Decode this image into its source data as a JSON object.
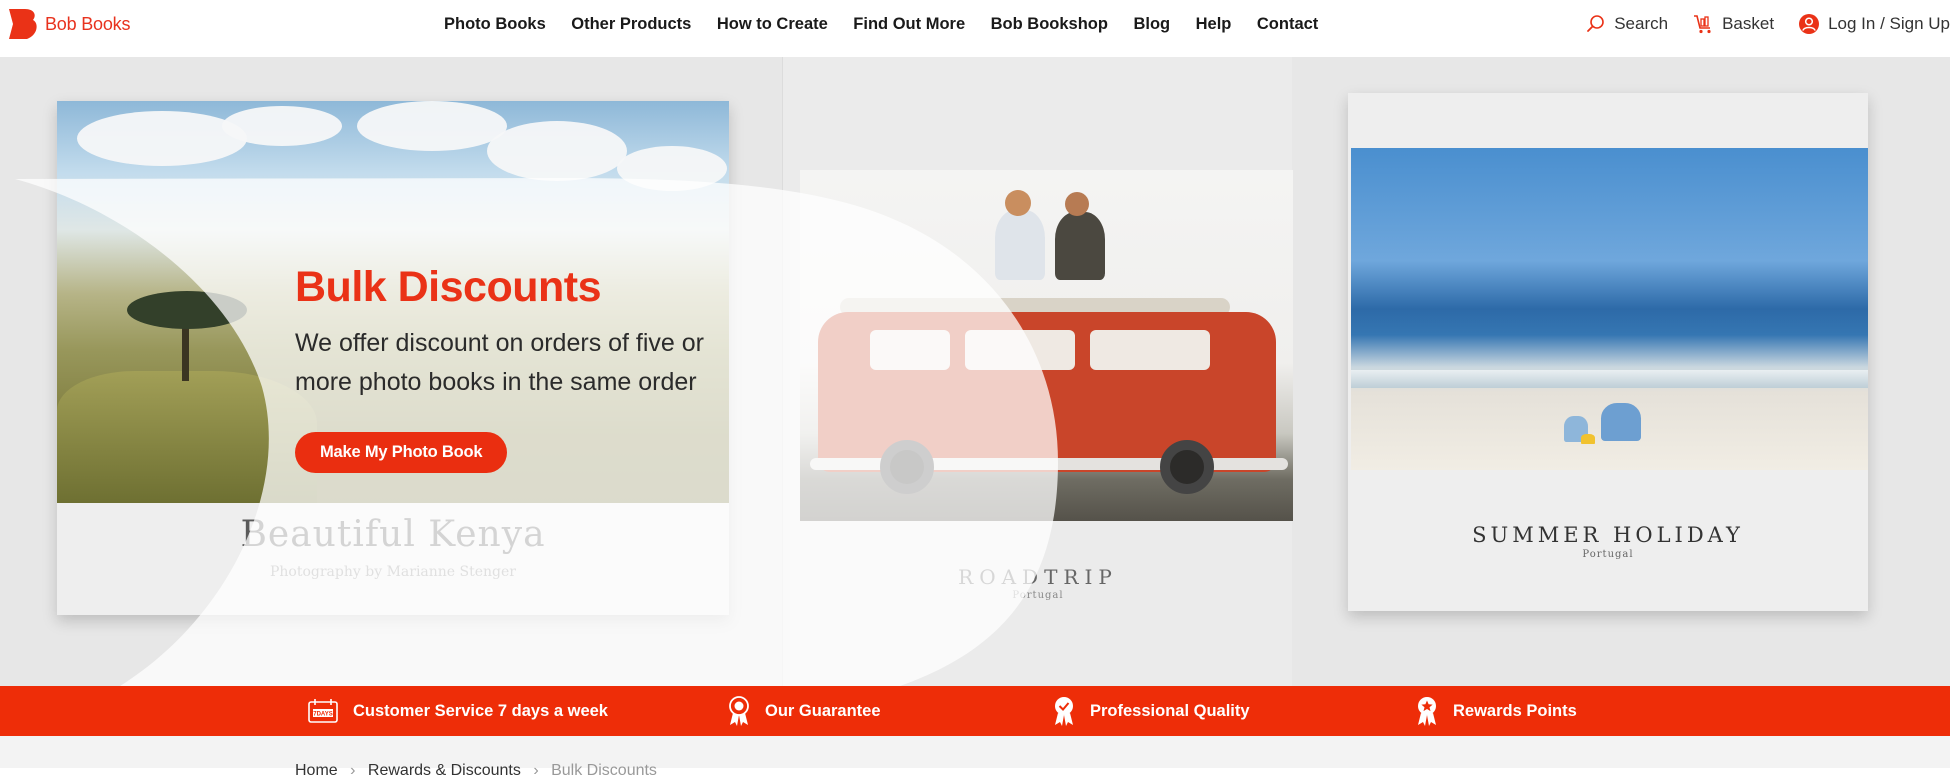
{
  "brand": {
    "name": "Bob Books",
    "color": "#e8321e"
  },
  "nav": {
    "items": [
      {
        "label": "Photo Books"
      },
      {
        "label": "Other Products"
      },
      {
        "label": "How to Create"
      },
      {
        "label": "Find Out More"
      },
      {
        "label": "Bob Bookshop"
      },
      {
        "label": "Blog"
      },
      {
        "label": "Help"
      },
      {
        "label": "Contact"
      }
    ]
  },
  "utility": {
    "search_label": "Search",
    "basket_label": "Basket",
    "login_label": "Log In / Sign Up",
    "search_icon": "search-icon",
    "basket_icon": "basket-icon",
    "user_icon": "user-icon"
  },
  "hero": {
    "title": "Bulk Discounts",
    "subtitle": "We offer discount on orders of five or more photo books in the same order",
    "cta_label": "Make My Photo Book",
    "books": {
      "left": {
        "title": "Beautiful Kenya",
        "subtitle": "Photography by Marianne Stenger"
      },
      "middle": {
        "title": "ROADTRIP",
        "subtitle": "Portugal"
      },
      "right": {
        "title": "SUMMER HOLIDAY",
        "subtitle": "Portugal"
      }
    }
  },
  "benefits": [
    {
      "label": "Customer Service 7 days a week",
      "icon": "calendar-icon"
    },
    {
      "label": "Our Guarantee",
      "icon": "award-ribbon-icon"
    },
    {
      "label": "Professional Quality",
      "icon": "quality-badge-icon"
    },
    {
      "label": "Rewards Points",
      "icon": "star-ribbon-icon"
    }
  ],
  "breadcrumb": {
    "items": [
      "Home",
      "Rewards & Discounts",
      "Bulk Discounts"
    ]
  },
  "colors": {
    "accent": "#ea2e10",
    "text_dark": "#1a1a1a"
  }
}
